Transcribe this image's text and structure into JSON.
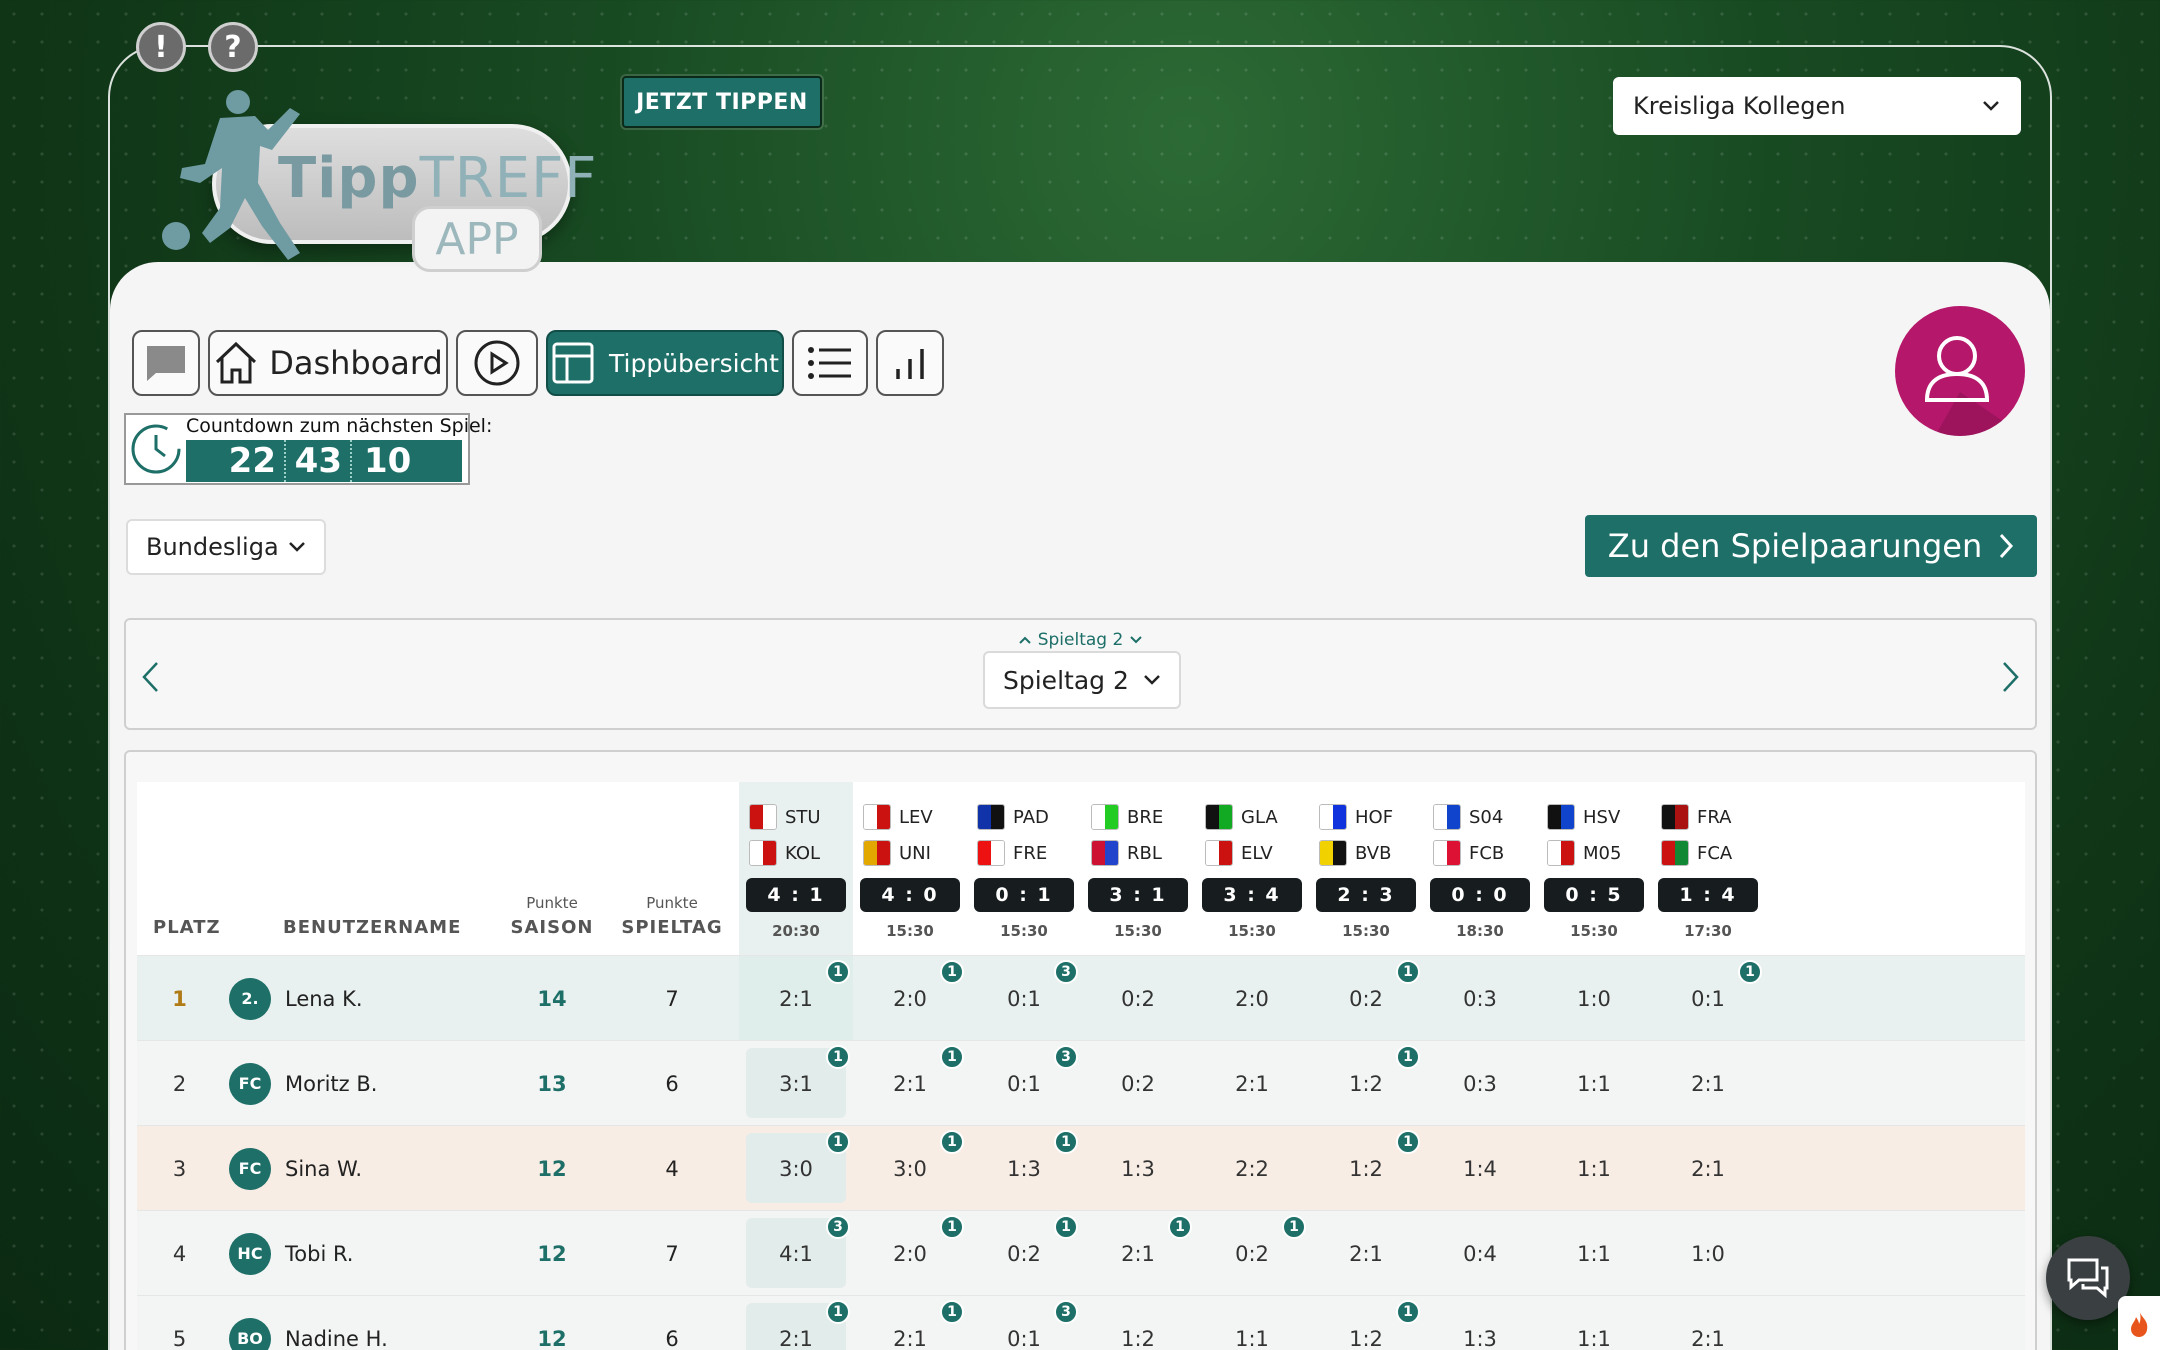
{
  "header": {
    "alert_icon": "!",
    "help_icon": "?",
    "logo_word_bold": "Tipp",
    "logo_word_thin": "TREFF",
    "logo_app": "APP",
    "jetzt_tippen": "JETZT TIPPEN",
    "league": "Kreisliga Kollegen"
  },
  "nav": {
    "dashboard": "Dashboard",
    "tippuebersicht": "Tippübersicht"
  },
  "countdown": {
    "label": "Countdown zum nächsten Spiel:",
    "hours": "22",
    "minutes": "43",
    "seconds": "10"
  },
  "competition": "Bundesliga",
  "pairings_button": "Zu den Spielpaarungen",
  "matchday": {
    "mini_label": "Spieltag 2",
    "selected": "Spieltag 2"
  },
  "table": {
    "headers": {
      "platz": "PLATZ",
      "benutzername": "BENUTZERNAME",
      "punkte_saison_top": "Punkte",
      "punkte_saison": "SAISON",
      "punkte_spieltag_top": "Punkte",
      "punkte_spieltag": "SPIELTAG"
    },
    "matches": [
      {
        "home": "STU",
        "away": "KOL",
        "score": "4 : 1",
        "time": "20:30",
        "home_colors": [
          "#cc1111",
          "#ffffff"
        ],
        "away_colors": [
          "#ffffff",
          "#cc1111"
        ],
        "active": true
      },
      {
        "home": "LEV",
        "away": "UNI",
        "score": "4 : 0",
        "time": "15:30",
        "home_colors": [
          "#ffffff",
          "#cc1111"
        ],
        "away_colors": [
          "#e3a800",
          "#cc1111"
        ],
        "active": false
      },
      {
        "home": "PAD",
        "away": "FRE",
        "score": "0 : 1",
        "time": "15:30",
        "home_colors": [
          "#1133aa",
          "#111111"
        ],
        "away_colors": [
          "#ee1111",
          "#ffffff"
        ],
        "active": false
      },
      {
        "home": "BRE",
        "away": "RBL",
        "score": "3 : 1",
        "time": "15:30",
        "home_colors": [
          "#ffffff",
          "#22cc22"
        ],
        "away_colors": [
          "#cc1133",
          "#2244cc"
        ],
        "active": false
      },
      {
        "home": "GLA",
        "away": "ELV",
        "score": "3 : 4",
        "time": "15:30",
        "home_colors": [
          "#111111",
          "#11aa22"
        ],
        "away_colors": [
          "#ffffff",
          "#cc1111"
        ],
        "active": false
      },
      {
        "home": "HOF",
        "away": "BVB",
        "score": "2 : 3",
        "time": "15:30",
        "home_colors": [
          "#ffffff",
          "#1133dd"
        ],
        "away_colors": [
          "#f2d100",
          "#111111"
        ],
        "active": false
      },
      {
        "home": "S04",
        "away": "FCB",
        "score": "0 : 0",
        "time": "18:30",
        "home_colors": [
          "#ffffff",
          "#1144cc"
        ],
        "away_colors": [
          "#ffffff",
          "#dd1133"
        ],
        "active": false
      },
      {
        "home": "HSV",
        "away": "M05",
        "score": "0 : 5",
        "time": "15:30",
        "home_colors": [
          "#111111",
          "#1144cc"
        ],
        "away_colors": [
          "#ffffff",
          "#cc1111"
        ],
        "active": false
      },
      {
        "home": "FRA",
        "away": "FCA",
        "score": "1 : 4",
        "time": "17:30",
        "home_colors": [
          "#111111",
          "#aa1111"
        ],
        "away_colors": [
          "#cc1111",
          "#118833"
        ],
        "active": false
      }
    ],
    "rows": [
      {
        "rank": "1",
        "badge": "2.",
        "name": "Lena K.",
        "saison": "14",
        "spieltag": "7",
        "bg": "#e8f1ef",
        "rank_color": "#b07a14",
        "tips": [
          {
            "t": "2:1",
            "p": "1"
          },
          {
            "t": "2:0",
            "p": "1"
          },
          {
            "t": "0:1",
            "p": "3"
          },
          {
            "t": "0:2",
            "p": ""
          },
          {
            "t": "2:0",
            "p": ""
          },
          {
            "t": "0:2",
            "p": "1"
          },
          {
            "t": "0:3",
            "p": ""
          },
          {
            "t": "1:0",
            "p": ""
          },
          {
            "t": "0:1",
            "p": "1"
          }
        ]
      },
      {
        "rank": "2",
        "badge": "FC",
        "name": "Moritz B.",
        "saison": "13",
        "spieltag": "6",
        "bg": "#f3f4f4",
        "rank_color": "#333",
        "tips": [
          {
            "t": "3:1",
            "p": "1"
          },
          {
            "t": "2:1",
            "p": "1"
          },
          {
            "t": "0:1",
            "p": "3"
          },
          {
            "t": "0:2",
            "p": ""
          },
          {
            "t": "2:1",
            "p": ""
          },
          {
            "t": "1:2",
            "p": "1"
          },
          {
            "t": "0:3",
            "p": ""
          },
          {
            "t": "1:1",
            "p": ""
          },
          {
            "t": "2:1",
            "p": ""
          }
        ]
      },
      {
        "rank": "3",
        "badge": "FC",
        "name": "Sina W.",
        "saison": "12",
        "spieltag": "4",
        "bg": "#f8ede4",
        "rank_color": "#333",
        "tips": [
          {
            "t": "3:0",
            "p": "1"
          },
          {
            "t": "3:0",
            "p": "1"
          },
          {
            "t": "1:3",
            "p": "1"
          },
          {
            "t": "1:3",
            "p": ""
          },
          {
            "t": "2:2",
            "p": ""
          },
          {
            "t": "1:2",
            "p": "1"
          },
          {
            "t": "1:4",
            "p": ""
          },
          {
            "t": "1:1",
            "p": ""
          },
          {
            "t": "2:1",
            "p": ""
          }
        ]
      },
      {
        "rank": "4",
        "badge": "HC",
        "name": "Tobi R.",
        "saison": "12",
        "spieltag": "7",
        "bg": "#f3f4f4",
        "rank_color": "#333",
        "tips": [
          {
            "t": "4:1",
            "p": "3"
          },
          {
            "t": "2:0",
            "p": "1"
          },
          {
            "t": "0:2",
            "p": "1"
          },
          {
            "t": "2:1",
            "p": "1"
          },
          {
            "t": "0:2",
            "p": "1"
          },
          {
            "t": "2:1",
            "p": ""
          },
          {
            "t": "0:4",
            "p": ""
          },
          {
            "t": "1:1",
            "p": ""
          },
          {
            "t": "1:0",
            "p": ""
          }
        ]
      },
      {
        "rank": "5",
        "badge": "BO",
        "name": "Nadine H.",
        "saison": "12",
        "spieltag": "6",
        "bg": "#f3f4f4",
        "rank_color": "#333",
        "tips": [
          {
            "t": "2:1",
            "p": "1"
          },
          {
            "t": "2:1",
            "p": "1"
          },
          {
            "t": "0:1",
            "p": "3"
          },
          {
            "t": "1:2",
            "p": ""
          },
          {
            "t": "1:1",
            "p": ""
          },
          {
            "t": "1:2",
            "p": "1"
          },
          {
            "t": "1:3",
            "p": ""
          },
          {
            "t": "1:1",
            "p": ""
          },
          {
            "t": "2:1",
            "p": ""
          }
        ]
      }
    ]
  },
  "colors": {
    "accent": "#1d6f68",
    "avatar": "#b5186b",
    "pill_dark": "#171c1e"
  }
}
